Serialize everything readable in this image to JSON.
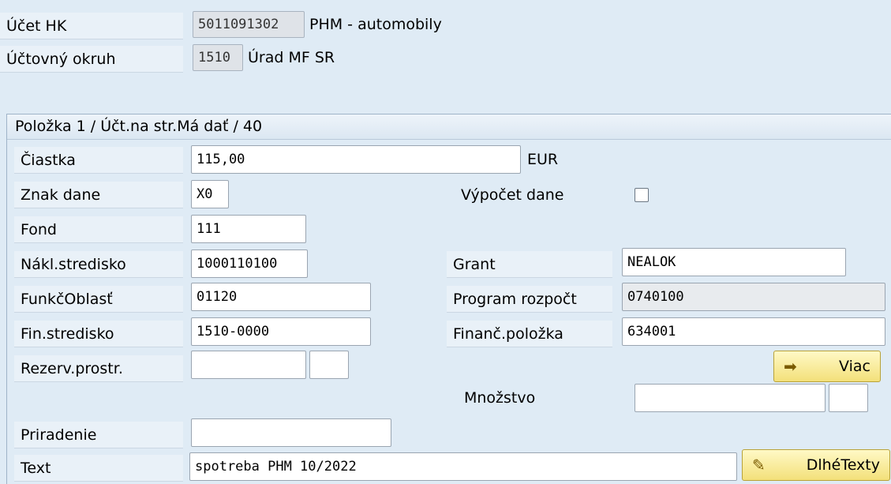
{
  "header": {
    "account_label": "Účet HK",
    "account_code": "5011091302",
    "account_name": "PHM - automobily",
    "company_label": "Účtovný okruh",
    "company_code": "1510",
    "company_name": "Úrad MF SR"
  },
  "group": {
    "title": "Položka 1 / Účt.na str.Má dať / 40"
  },
  "fields": {
    "amount_label": "Čiastka",
    "amount_value": "115,00",
    "currency": "EUR",
    "tax_code_label": "Znak dane",
    "tax_code_value": "X0",
    "tax_calc_label": "Výpočet dane",
    "fund_label": "Fond",
    "fund_value": "111",
    "cost_center_label": "Nákl.stredisko",
    "cost_center_value": "1000110100",
    "grant_label": "Grant",
    "grant_value": "NEALOK",
    "func_area_label": "FunkčOblasť",
    "func_area_value": "01120",
    "program_label": "Program rozpočt",
    "program_value": "0740100",
    "fin_center_label": "Fin.stredisko",
    "fin_center_value": "1510-0000",
    "fin_item_label": "Finanč.položka",
    "fin_item_value": "634001",
    "reserve_label": "Rezerv.prostr.",
    "reserve_value": "",
    "reserve_value2": "",
    "quantity_label": "Množstvo",
    "quantity_value": "",
    "quantity_unit": "",
    "assignment_label": "Priradenie",
    "assignment_value": "",
    "text_label": "Text",
    "text_value": "spotreba PHM 10/2022"
  },
  "buttons": {
    "more_label": "Viac",
    "more_icon": "arrow-right-icon",
    "long_texts_label": "DlhéTexty",
    "long_texts_icon": "pencil-icon"
  },
  "colors": {
    "background": "#dfebf5",
    "button_yellow": "#f3e07a"
  }
}
